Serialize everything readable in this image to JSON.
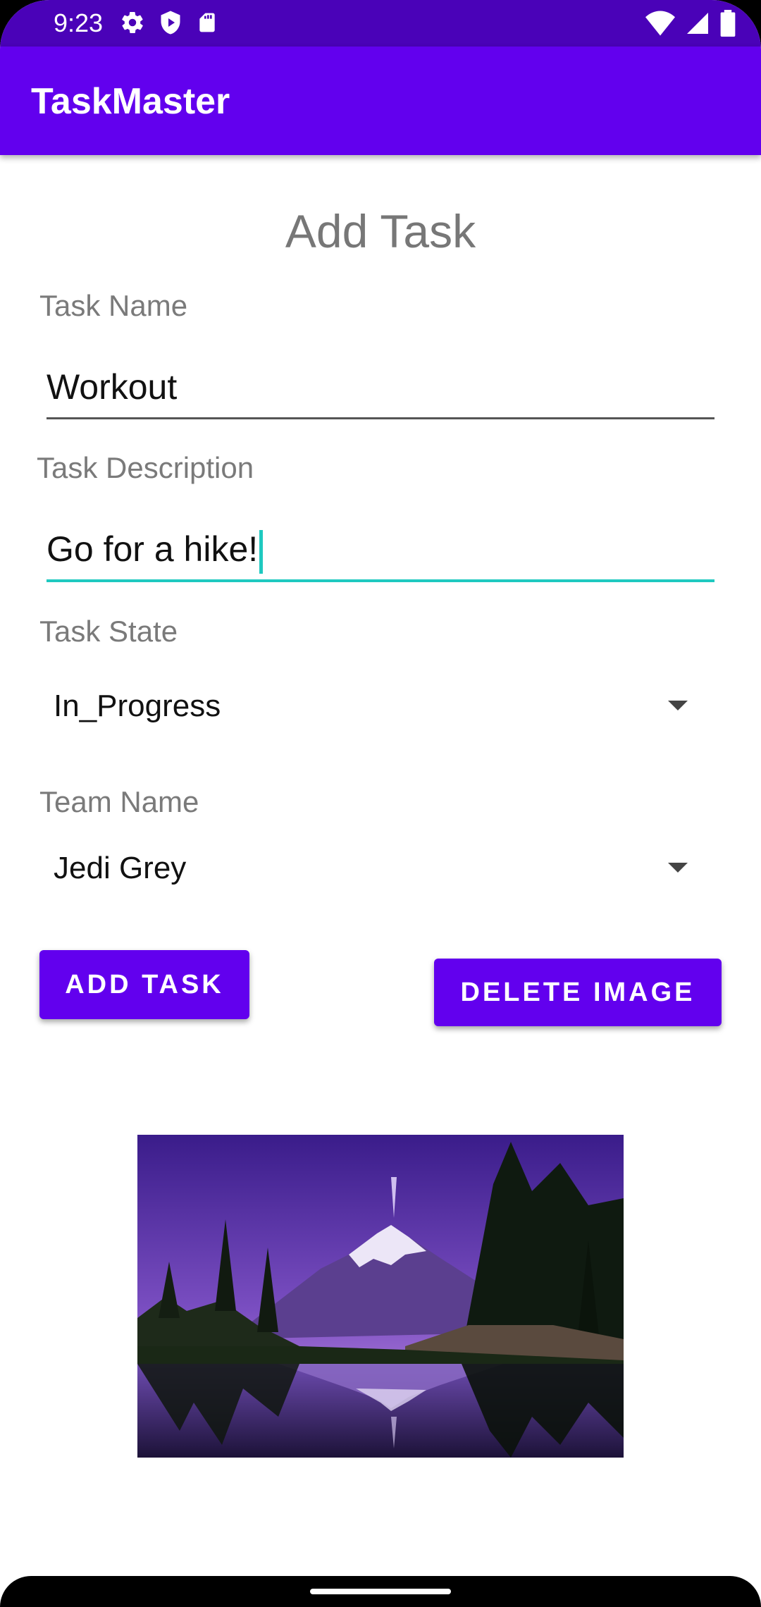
{
  "status": {
    "time": "9:23",
    "left_icons": [
      "gear-icon",
      "shield-play-icon",
      "sd-card-icon"
    ],
    "right_icons": [
      "wifi-icon",
      "signal-icon",
      "battery-icon"
    ]
  },
  "app_bar": {
    "title": "TaskMaster"
  },
  "form": {
    "heading": "Add Task",
    "task_name_label": "Task Name",
    "task_name_value": "Workout",
    "task_description_label": "Task Description",
    "task_description_value": "Go for a hike!",
    "task_state_label": "Task State",
    "task_state_selected": "In_Progress",
    "team_name_label": "Team Name",
    "team_name_selected": "Jedi Grey"
  },
  "buttons": {
    "add_task": "ADD TASK",
    "delete_image": "DELETE IMAGE"
  },
  "colors": {
    "primary": "#6200ee",
    "status_bar": "#4a02b8",
    "focus": "#1fc9c0"
  }
}
